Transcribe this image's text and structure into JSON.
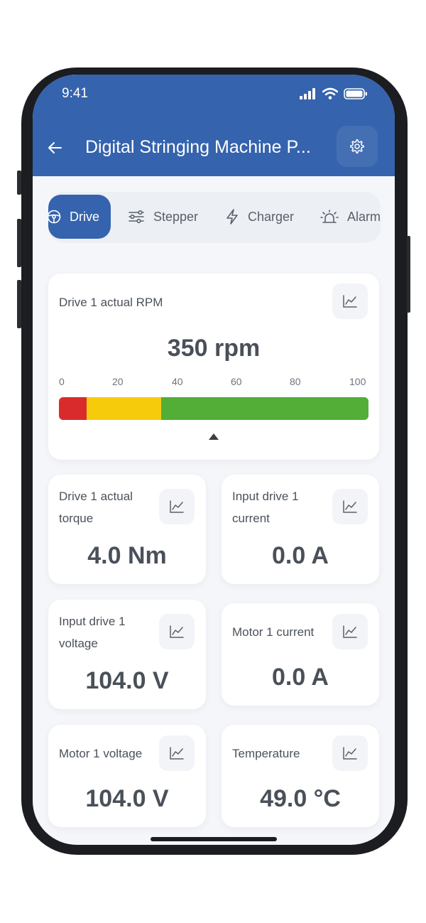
{
  "status": {
    "time": "9:41"
  },
  "header": {
    "title": "Digital Stringing Machine P..."
  },
  "tabs": [
    {
      "label": "Drive",
      "icon": "steering-wheel-icon",
      "active": true
    },
    {
      "label": "Stepper",
      "icon": "sliders-icon",
      "active": false
    },
    {
      "label": "Charger",
      "icon": "lightning-icon",
      "active": false
    },
    {
      "label": "Alarm",
      "icon": "siren-icon",
      "active": false
    }
  ],
  "rpm_card": {
    "label": "Drive 1 actual RPM",
    "value": "350 rpm",
    "scale": [
      "0",
      "20",
      "40",
      "60",
      "80",
      "100"
    ],
    "segments": [
      {
        "color": "#d92b2b",
        "from": 0,
        "to": 9
      },
      {
        "color": "#f6cb0b",
        "from": 9,
        "to": 33
      },
      {
        "color": "#52ae36",
        "from": 33,
        "to": 100
      }
    ],
    "indicator_percent": 50
  },
  "metrics": [
    {
      "label": "Drive 1 actual torque",
      "value": "4.0 Nm"
    },
    {
      "label": "Input drive 1 current",
      "value": "0.0 A"
    },
    {
      "label": "Input drive 1 voltage",
      "value": "104.0 V"
    },
    {
      "label": "Motor 1 current",
      "value": "0.0 A"
    },
    {
      "label": "Motor 1 voltage",
      "value": "104.0 V"
    },
    {
      "label": "Temperature",
      "value": "49.0 °C"
    }
  ],
  "colors": {
    "primary": "#3563ad",
    "background": "#f4f6f9"
  }
}
